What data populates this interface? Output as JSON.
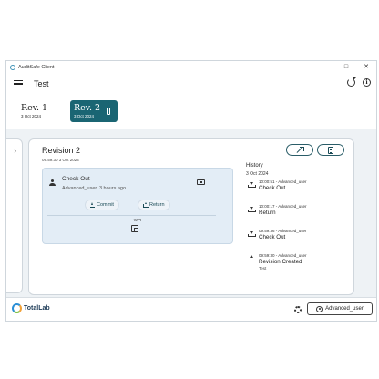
{
  "window": {
    "title": "AuditSafe Client",
    "controls": {
      "minimize": "—",
      "maximize": "□",
      "close": "✕"
    }
  },
  "appbar": {
    "title": "Test"
  },
  "revisions": [
    {
      "label": "Rev. 1",
      "date": "3 Oct 2024",
      "active": false
    },
    {
      "label": "Rev. 2",
      "date": "3 Oct 2024",
      "active": true
    }
  ],
  "revision": {
    "title": "Revision 2",
    "subtitle": "09:59:30 3 Oct 2024",
    "checkout": {
      "status": "Check Out",
      "detail": "Advanced_user, 3 hours ago",
      "commit_label": "Commit",
      "return_label": "Return",
      "wpi_label": "WPI"
    }
  },
  "history": {
    "heading": "History",
    "date": "3 Oct 2024",
    "items": [
      {
        "time": "10:00:51 - Advanced_user",
        "action": "Check Out",
        "icon": "download-icon"
      },
      {
        "time": "10:00:17 - Advanced_user",
        "action": "Return",
        "icon": "download-icon"
      },
      {
        "time": "09:59:36 - Advanced_user",
        "action": "Check Out",
        "icon": "download-icon"
      },
      {
        "time": "09:59:30 - Advanced_user",
        "action": "Revision Created",
        "note": "Test",
        "icon": "upload-icon"
      }
    ]
  },
  "footer": {
    "logo_text": "TotalLab",
    "user_label": "Advanced_user"
  },
  "colors": {
    "accent": "#1a6573",
    "card_blue": "#e3edf6",
    "background": "#eef2f5"
  }
}
